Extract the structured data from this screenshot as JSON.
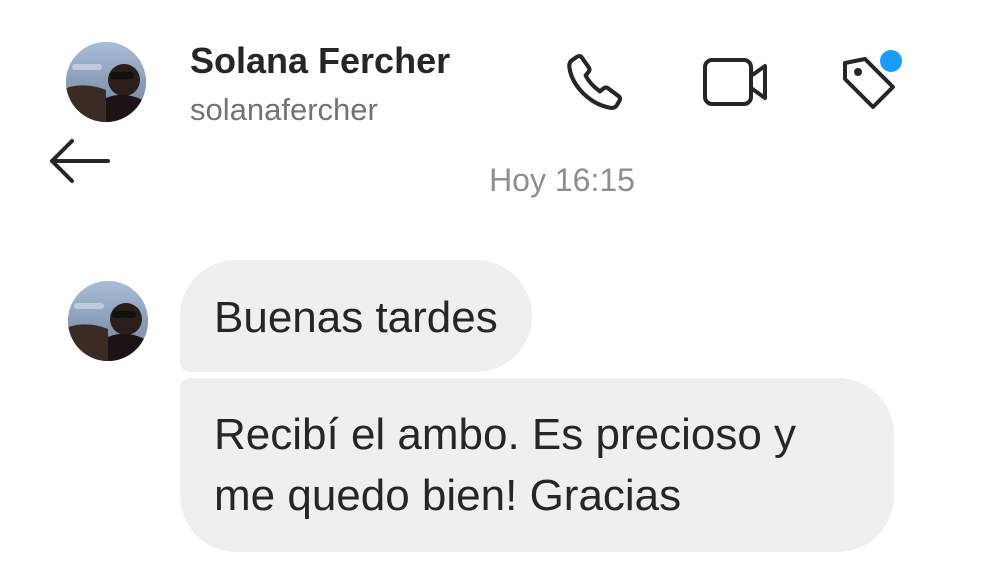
{
  "header": {
    "name": "Solana Fercher",
    "username": "solanafercher",
    "back_icon": "arrow-left-icon",
    "actions": [
      {
        "icon": "phone-icon"
      },
      {
        "icon": "video-camera-icon"
      },
      {
        "icon": "tag-icon",
        "badge": "notification-dot"
      }
    ]
  },
  "conversation": {
    "timestamp": "Hoy 16:15",
    "messages": [
      {
        "text": "Buenas tardes"
      },
      {
        "text": "Recibí el ambo. Es precioso y me quedo bien! Gracias"
      }
    ]
  },
  "colors": {
    "text_primary": "#262626",
    "text_secondary": "#737373",
    "timestamp": "#8e8e8e",
    "bubble_background": "#efefef",
    "notification_dot": "#1a9cfc"
  }
}
